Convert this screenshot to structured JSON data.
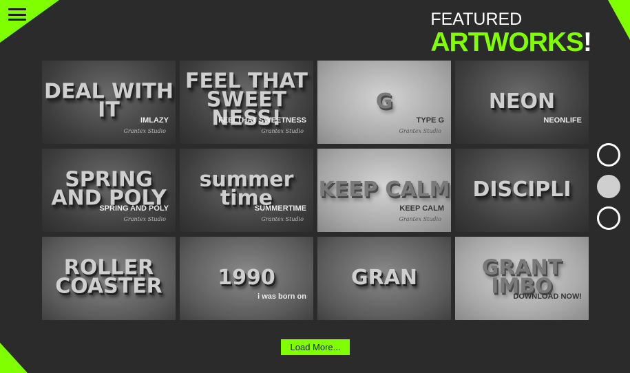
{
  "header": {
    "title_line1": "FEATURED",
    "title_line2": "ARTWORKS",
    "title_bang": "!"
  },
  "menu": {
    "icon": "hamburger-menu-icon"
  },
  "accent_color": "#7fff00",
  "artworks": [
    {
      "art": "DEAL WITH IT",
      "caption": "IMLAZY",
      "studio": "Grantex Studio",
      "tone": "dark"
    },
    {
      "art": "FEEL THAT SWEET NESS!",
      "caption": "FEELTHAT SWEETNESS",
      "studio": "Grantex Studio",
      "tone": "dark"
    },
    {
      "art": "G",
      "caption": "TYPE G",
      "studio": "Grantex Studio",
      "tone": "light"
    },
    {
      "art": "NEON",
      "caption": "NEONLIFE",
      "studio": "",
      "tone": "dark"
    },
    {
      "art": "SPRING AND POLY",
      "caption": "SPRING AND POLY",
      "studio": "Grantex Studio",
      "tone": "dark"
    },
    {
      "art": "summer time",
      "caption": "SUMMERTIME",
      "studio": "Grantex Studio",
      "tone": "dark"
    },
    {
      "art": "KEEP CALM",
      "caption": "KEEP CALM",
      "studio": "Grantex Studio",
      "tone": "light"
    },
    {
      "art": "DISCIPLI",
      "caption": "",
      "studio": "",
      "tone": "dark"
    },
    {
      "art": "ROLLER COASTER",
      "caption": "",
      "studio": "",
      "tone": "mid"
    },
    {
      "art": "1990",
      "caption": "i was born on",
      "studio": "",
      "tone": "mid"
    },
    {
      "art": "GRAN",
      "caption": "",
      "studio": "",
      "tone": "mid"
    },
    {
      "art": "GRANT IMBO",
      "caption": "DOWNLOAD NOW!",
      "studio": "",
      "tone": "light"
    }
  ],
  "pagination": {
    "pages": 3,
    "active_index": 1
  },
  "load_more_label": "Load More..."
}
